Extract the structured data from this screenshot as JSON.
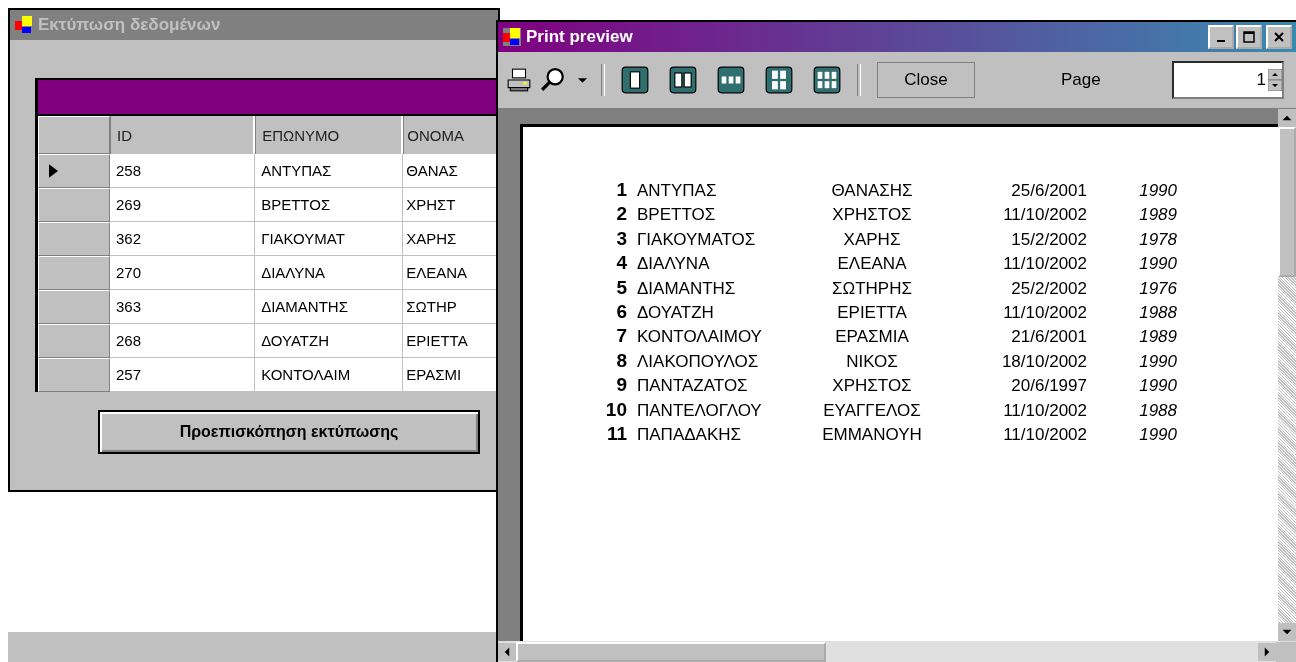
{
  "data_window": {
    "title": "Εκτύπωση δεδομένων",
    "active": false,
    "grid": {
      "columns": [
        "ID",
        "ΕΠΩΝΥΜΟ",
        "ΟΝΟΜΑ"
      ],
      "rows": [
        {
          "selected": true,
          "cells": [
            "258",
            "ΑΝΤΥΠΑΣ",
            "ΘΑΝΑΣ"
          ]
        },
        {
          "selected": false,
          "cells": [
            "269",
            "ΒΡΕΤΤΟΣ",
            "ΧΡΗΣΤ"
          ]
        },
        {
          "selected": false,
          "cells": [
            "362",
            "ΓΙΑΚΟΥΜΑΤ",
            "ΧΑΡΗΣ"
          ]
        },
        {
          "selected": false,
          "cells": [
            "270",
            "ΔΙΑΛΥΝΑ",
            "ΕΛΕΑΝΑ"
          ]
        },
        {
          "selected": false,
          "cells": [
            "363",
            "ΔΙΑΜΑΝΤΗΣ",
            "ΣΩΤΗΡ"
          ]
        },
        {
          "selected": false,
          "cells": [
            "268",
            "ΔΟΥΑΤΖΗ",
            "ΕΡΙΕΤΤΑ"
          ]
        },
        {
          "selected": false,
          "cells": [
            "257",
            "ΚΟΝΤΟΛΑΙΜ",
            "ΕΡΑΣΜΙ"
          ]
        }
      ]
    },
    "preview_button": "Προεπισκόπηση εκτύπωσης"
  },
  "preview_window": {
    "title": "Print preview",
    "active": true,
    "toolbar": {
      "close_button": "Close",
      "page_label": "Page",
      "page_value": "1"
    },
    "report_rows": [
      {
        "number": "1",
        "surname": "ΑΝΤΥΠΑΣ",
        "name": "ΘΑΝΑΣΗΣ",
        "date": "25/6/2001",
        "year": "1990"
      },
      {
        "number": "2",
        "surname": "ΒΡΕΤΤΟΣ",
        "name": "ΧΡΗΣΤΟΣ",
        "date": "11/10/2002",
        "year": "1989"
      },
      {
        "number": "3",
        "surname": "ΓΙΑΚΟΥΜΑΤΟΣ",
        "name": "ΧΑΡΗΣ",
        "date": "15/2/2002",
        "year": "1978"
      },
      {
        "number": "4",
        "surname": "ΔΙΑΛΥΝΑ",
        "name": "ΕΛΕΑΝΑ",
        "date": "11/10/2002",
        "year": "1990"
      },
      {
        "number": "5",
        "surname": "ΔΙΑΜΑΝΤΗΣ",
        "name": "ΣΩΤΗΡΗΣ",
        "date": "25/2/2002",
        "year": "1976"
      },
      {
        "number": "6",
        "surname": "ΔΟΥΑΤΖΗ",
        "name": "ΕΡΙΕΤΤΑ",
        "date": "11/10/2002",
        "year": "1988"
      },
      {
        "number": "7",
        "surname": "ΚΟΝΤΟΛΑΙΜΟΥ",
        "name": "ΕΡΑΣΜΙΑ",
        "date": "21/6/2001",
        "year": "1989"
      },
      {
        "number": "8",
        "surname": "ΛΙΑΚΟΠΟΥΛΟΣ",
        "name": "ΝΙΚΟΣ",
        "date": "18/10/2002",
        "year": "1990"
      },
      {
        "number": "9",
        "surname": "ΠΑΝΤΑΖΑΤΟΣ",
        "name": "ΧΡΗΣΤΟΣ",
        "date": "20/6/1997",
        "year": "1990"
      },
      {
        "number": "10",
        "surname": "ΠΑΝΤΕΛΟΓΛΟΥ",
        "name": "ΕΥΑΓΓΕΛΟΣ",
        "date": "11/10/2002",
        "year": "1988"
      },
      {
        "number": "11",
        "surname": "ΠΑΠΑΔΑΚΗΣ",
        "name": "ΕΜΜΑΝΟΥΗ",
        "date": "11/10/2002",
        "year": "1990"
      }
    ]
  }
}
